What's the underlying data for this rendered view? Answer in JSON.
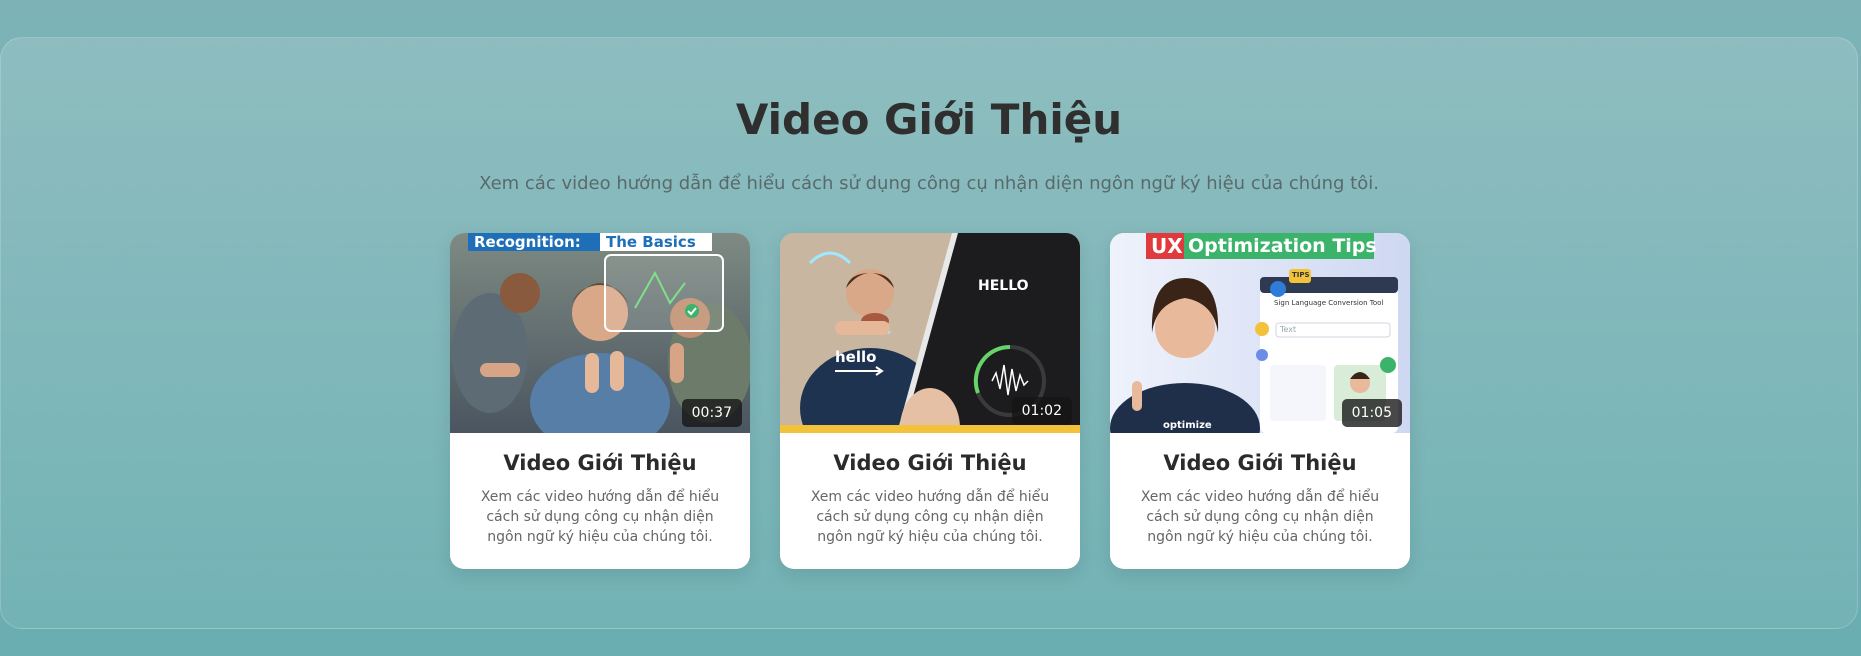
{
  "section": {
    "title": "Video Giới Thiệu",
    "subtitle": "Xem các video hướng dẫn để hiểu cách sử dụng công cụ nhận diện ngôn ngữ ký hiệu của chúng tôi."
  },
  "videos": [
    {
      "title": "Video Giới Thiệu",
      "description": "Xem các video hướng dẫn để hiểu cách sử dụng công cụ nhận diện ngôn ngữ ký hiệu của chúng tôi.",
      "duration": "00:37",
      "thumbnail_text_1": "Recognition:",
      "thumbnail_text_2": "The Basics"
    },
    {
      "title": "Video Giới Thiệu",
      "description": "Xem các video hướng dẫn để hiểu cách sử dụng công cụ nhận diện ngôn ngữ ký hiệu của chúng tôi.",
      "duration": "01:02",
      "thumbnail_text_1": "hello",
      "thumbnail_text_2": "HELLO"
    },
    {
      "title": "Video Giới Thiệu",
      "description": "Xem các video hướng dẫn để hiểu cách sử dụng công cụ nhận diện ngôn ngữ ký hiệu của chúng tôi.",
      "duration": "01:05",
      "thumbnail_text_1": "UX",
      "thumbnail_text_2": "Optimization Tips",
      "thumbnail_text_3": "optimize",
      "thumbnail_text_4": "Sign Language Conversion Tool",
      "thumbnail_text_5": "Text",
      "thumbnail_text_6": "TIPS"
    }
  ],
  "colors": {
    "background": "#6aaeb1",
    "card": "#ffffff",
    "title": "#2f2f2f",
    "accent_blue": "#1e6fb8",
    "accent_red": "#e0393e",
    "accent_green": "#3bb36a",
    "accent_yellow": "#f2c23a"
  }
}
